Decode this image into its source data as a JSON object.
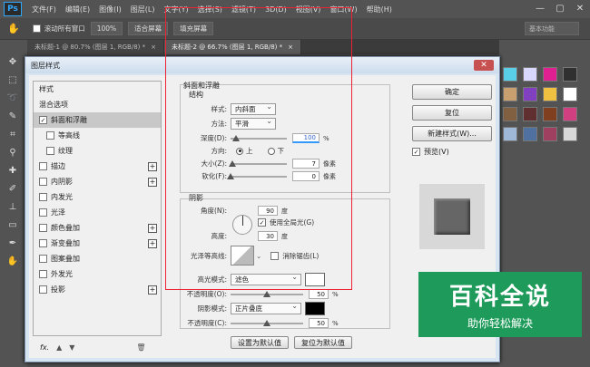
{
  "app": {
    "logo": "Ps",
    "menus": [
      "文件(F)",
      "编辑(E)",
      "图像(I)",
      "图层(L)",
      "文字(Y)",
      "选择(S)",
      "滤镜(T)",
      "3D(D)",
      "视图(V)",
      "窗口(W)",
      "帮助(H)"
    ],
    "window_controls": [
      "—",
      "▢",
      "✕"
    ]
  },
  "options_bar": {
    "scroll_all": "滚动所有窗口",
    "zoom": "100%",
    "fit_screen": "适合屏幕",
    "fill_screen": "填充屏幕",
    "workspace": "基本功能"
  },
  "tabs": [
    {
      "label": "未标题-1 @ 80.7% (图层 1, RGB/8) *",
      "close": "×"
    },
    {
      "label": "未标题-2 @ 66.7% (图层 1, RGB/8) *",
      "close": "×"
    }
  ],
  "swatch_colors": [
    "#5ad0e8",
    "#d8d8ff",
    "#e02090",
    "#303030",
    "#c8a070",
    "#8040c0",
    "#f0c040",
    "#ffffff",
    "#806040",
    "#603030",
    "#804020",
    "#d04080",
    "#a0b8d8",
    "#5070a0",
    "#a04060",
    "#d8d8d8"
  ],
  "dialog": {
    "title": "图层样式",
    "close": "✕",
    "list": [
      {
        "label": "样式",
        "check": null,
        "plus": false,
        "selected": false,
        "sub": false
      },
      {
        "label": "混合选项",
        "check": null,
        "plus": false,
        "selected": false,
        "sub": false
      },
      {
        "label": "斜面和浮雕",
        "check": true,
        "plus": false,
        "selected": true,
        "sub": false
      },
      {
        "label": "等高线",
        "check": false,
        "plus": false,
        "selected": false,
        "sub": true
      },
      {
        "label": "纹理",
        "check": false,
        "plus": false,
        "selected": false,
        "sub": true
      },
      {
        "label": "描边",
        "check": false,
        "plus": true,
        "selected": false,
        "sub": false
      },
      {
        "label": "内阴影",
        "check": false,
        "plus": true,
        "selected": false,
        "sub": false
      },
      {
        "label": "内发光",
        "check": false,
        "plus": false,
        "selected": false,
        "sub": false
      },
      {
        "label": "光泽",
        "check": false,
        "plus": false,
        "selected": false,
        "sub": false
      },
      {
        "label": "颜色叠加",
        "check": false,
        "plus": true,
        "selected": false,
        "sub": false
      },
      {
        "label": "渐变叠加",
        "check": false,
        "plus": true,
        "selected": false,
        "sub": false
      },
      {
        "label": "图案叠加",
        "check": false,
        "plus": false,
        "selected": false,
        "sub": false
      },
      {
        "label": "外发光",
        "check": false,
        "plus": false,
        "selected": false,
        "sub": false
      },
      {
        "label": "投影",
        "check": false,
        "plus": true,
        "selected": false,
        "sub": false
      }
    ],
    "footer": {
      "fx": "fx.",
      "up": "▲",
      "down": "▼",
      "trash": "🗑"
    },
    "bevel": {
      "header": "斜面和浮雕",
      "structure": "结构",
      "style_label": "样式:",
      "style_value": "内斜面",
      "technique_label": "方法:",
      "technique_value": "平滑",
      "depth_label": "深度(D):",
      "depth_value": "100",
      "depth_unit": "%",
      "depth_level": 0.1,
      "direction_label": "方向:",
      "dir_up": "上",
      "dir_down": "下",
      "size_label": "大小(Z):",
      "size_value": "7",
      "size_unit": "像素",
      "size_level": 0.04,
      "soften_label": "软化(F):",
      "soften_value": "0",
      "soften_unit": "像素",
      "soften_level": 0.0
    },
    "shading": {
      "title": "阴影",
      "angle_label": "角度(N):",
      "angle_value": "90",
      "angle_unit": "度",
      "global_light": "使用全局光(G)",
      "altitude_label": "高度:",
      "altitude_value": "30",
      "altitude_unit": "度",
      "gloss_label": "光泽等高线:",
      "anti_alias": "消除锯齿(L)",
      "highlight_label": "高光模式:",
      "highlight_mode": "滤色",
      "highlight_color": "#ffffff",
      "hl_opacity_label": "不透明度(O):",
      "hl_opacity_value": "50",
      "hl_opacity_unit": "%",
      "hl_opacity_level": 0.5,
      "shadow_label": "阴影模式:",
      "shadow_mode": "正片叠底",
      "shadow_color": "#000000",
      "sh_opacity_label": "不透明度(C):",
      "sh_opacity_value": "50",
      "sh_opacity_unit": "%",
      "sh_opacity_level": 0.5
    },
    "set_default": "设置为默认值",
    "reset_default": "复位为默认值",
    "ok": "确定",
    "reset": "复位",
    "new_style": "新建样式(W)...",
    "preview": "预览(V)"
  },
  "watermark": {
    "top": "百科全说",
    "bottom": "助你轻松解决"
  }
}
